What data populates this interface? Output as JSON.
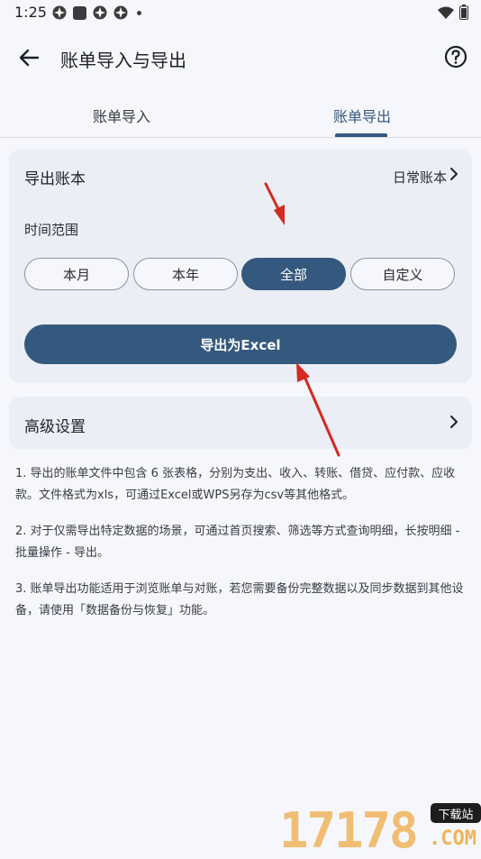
{
  "status_bar": {
    "time": "1:25"
  },
  "app_bar": {
    "title": "账单导入与导出"
  },
  "tabs": [
    {
      "label": "账单导入",
      "selected": false
    },
    {
      "label": "账单导出",
      "selected": true
    }
  ],
  "export_card": {
    "book_label": "导出账本",
    "book_value": "日常账本",
    "range_label": "时间范围",
    "range_options": [
      "本月",
      "本年",
      "全部",
      "自定义"
    ],
    "range_selected": "全部",
    "export_button": "导出为Excel"
  },
  "advanced": {
    "label": "高级设置"
  },
  "notes": [
    "1. 导出的账单文件中包含 6 张表格，分别为支出、收入、转账、借贷、应付款、应收款。文件格式为xls，可通过Excel或WPS另存为csv等其他格式。",
    "2. 对于仅需导出特定数据的场景，可通过首页搜索、筛选等方式查询明细，长按明细 - 批量操作 - 导出。",
    "3. 账单导出功能适用于浏览账单与对账，若您需要备份完整数据以及同步数据到其他设备，请使用「数据备份与恢复」功能。"
  ],
  "watermark": {
    "digits": "17178",
    "badge": "下载站",
    "domain": ".COM"
  },
  "colors": {
    "accent": "#35597e",
    "background": "#f6f7fc",
    "card": "#eceef5",
    "annotation_arrow": "#d42a20"
  }
}
